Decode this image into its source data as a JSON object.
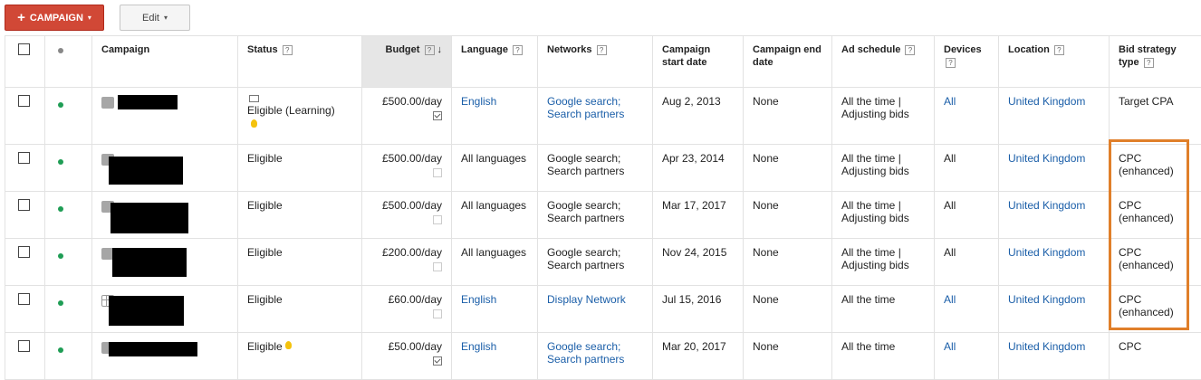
{
  "toolbar": {
    "campaign_button": "CAMPAIGN",
    "edit_button": "Edit",
    "plus_glyph": "+",
    "caret_glyph": "▾"
  },
  "columns": {
    "campaign": "Campaign",
    "status": "Status",
    "budget": "Budget",
    "language": "Language",
    "networks": "Networks",
    "start_date": "Campaign start date",
    "end_date": "Campaign end date",
    "ad_schedule": "Ad schedule",
    "devices": "Devices",
    "location": "Location",
    "bid_strategy": "Bid strategy type",
    "help_glyph": "?",
    "sort_glyph": "↓"
  },
  "rows": [
    {
      "status": "Eligible (Learning)",
      "budget": "£500.00/day",
      "language": "English",
      "networks": "Google search; Search partners",
      "start": "Aug 2, 2013",
      "end": "None",
      "schedule": "All the time | Adjusting bids",
      "devices": "All",
      "location": "United Kingdom",
      "bid": "Target CPA"
    },
    {
      "status": "Eligible",
      "budget": "£500.00/day",
      "language": "All languages",
      "networks": "Google search; Search partners",
      "start": "Apr 23, 2014",
      "end": "None",
      "schedule": "All the time | Adjusting bids",
      "devices": "All",
      "location": "United Kingdom",
      "bid": "CPC (enhanced)"
    },
    {
      "status": "Eligible",
      "budget": "£500.00/day",
      "language": "All languages",
      "networks": "Google search; Search partners",
      "start": "Mar 17, 2017",
      "end": "None",
      "schedule": "All the time | Adjusting bids",
      "devices": "All",
      "location": "United Kingdom",
      "bid": "CPC (enhanced)"
    },
    {
      "status": "Eligible",
      "budget": "£200.00/day",
      "language": "All languages",
      "networks": "Google search; Search partners",
      "start": "Nov 24, 2015",
      "end": "None",
      "schedule": "All the time | Adjusting bids",
      "devices": "All",
      "location": "United Kingdom",
      "bid": "CPC (enhanced)"
    },
    {
      "status": "Eligible",
      "budget": "£60.00/day",
      "language": "English",
      "networks": "Display Network",
      "start": "Jul 15, 2016",
      "end": "None",
      "schedule": "All the time",
      "devices": "All",
      "location": "United Kingdom",
      "bid": "CPC (enhanced)"
    },
    {
      "status": "Eligible",
      "budget": "£50.00/day",
      "language": "English",
      "networks": "Google search; Search partners",
      "start": "Mar 20, 2017",
      "end": "None",
      "schedule": "All the time",
      "devices": "All",
      "location": "United Kingdom",
      "bid": "CPC"
    }
  ],
  "colors": {
    "campaign_button": "#d14836",
    "link": "#1a5ea8",
    "enabled_dot": "#1f9d55",
    "highlight_box": "#e07f2a",
    "budget_header_bg": "#e6e6e6"
  }
}
